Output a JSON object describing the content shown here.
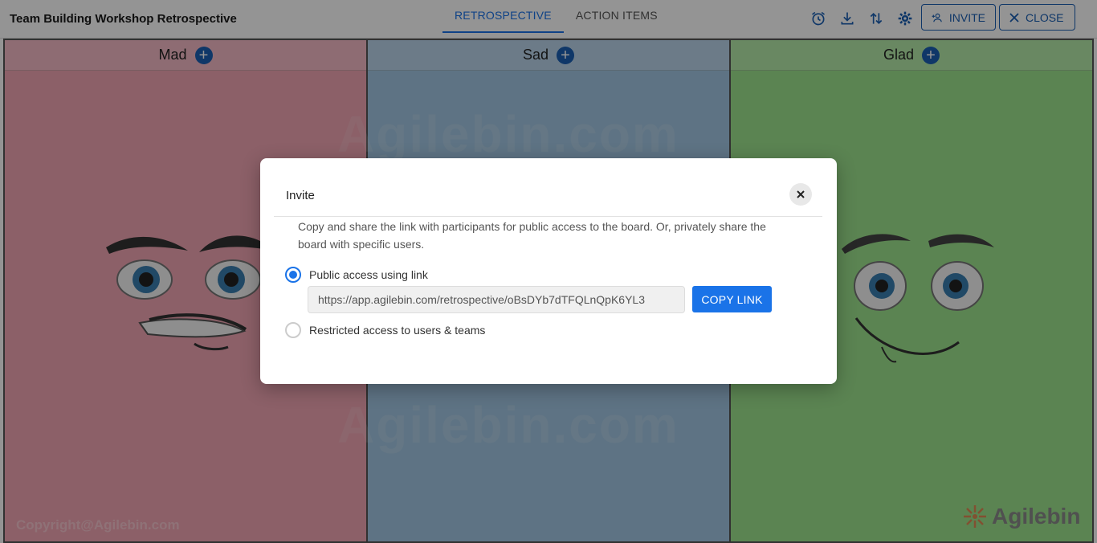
{
  "header": {
    "title": "Team Building Workshop Retrospective",
    "tabs": [
      {
        "label": "RETROSPECTIVE",
        "active": true
      },
      {
        "label": "ACTION ITEMS",
        "active": false
      }
    ],
    "icons": [
      "alarm-icon",
      "download-icon",
      "sort-icon",
      "gear-icon"
    ],
    "invite_label": "INVITE",
    "close_label": "CLOSE"
  },
  "columns": [
    {
      "label": "Mad",
      "color": "#f1a5b3"
    },
    {
      "label": "Sad",
      "color": "#a3c7e3"
    },
    {
      "label": "Glad",
      "color": "#9ee38d"
    }
  ],
  "watermark": "Agilebin.com",
  "copyright": "Copyright@Agilebin.com",
  "brand": "Agilebin",
  "dialog": {
    "title": "Invite",
    "description": "Copy and share the link with participants for public access to the board. Or, privately share the board with specific users.",
    "options": [
      {
        "label": "Public access using link",
        "checked": true
      },
      {
        "label": "Restricted access to users & teams",
        "checked": false
      }
    ],
    "link": "https://app.agilebin.com/retrospective/oBsDYb7dTFQLnQpK6YL3",
    "copy_label": "COPY LINK"
  },
  "colors": {
    "accent": "#1a73e8",
    "primary_dark": "#1a5fb4"
  }
}
